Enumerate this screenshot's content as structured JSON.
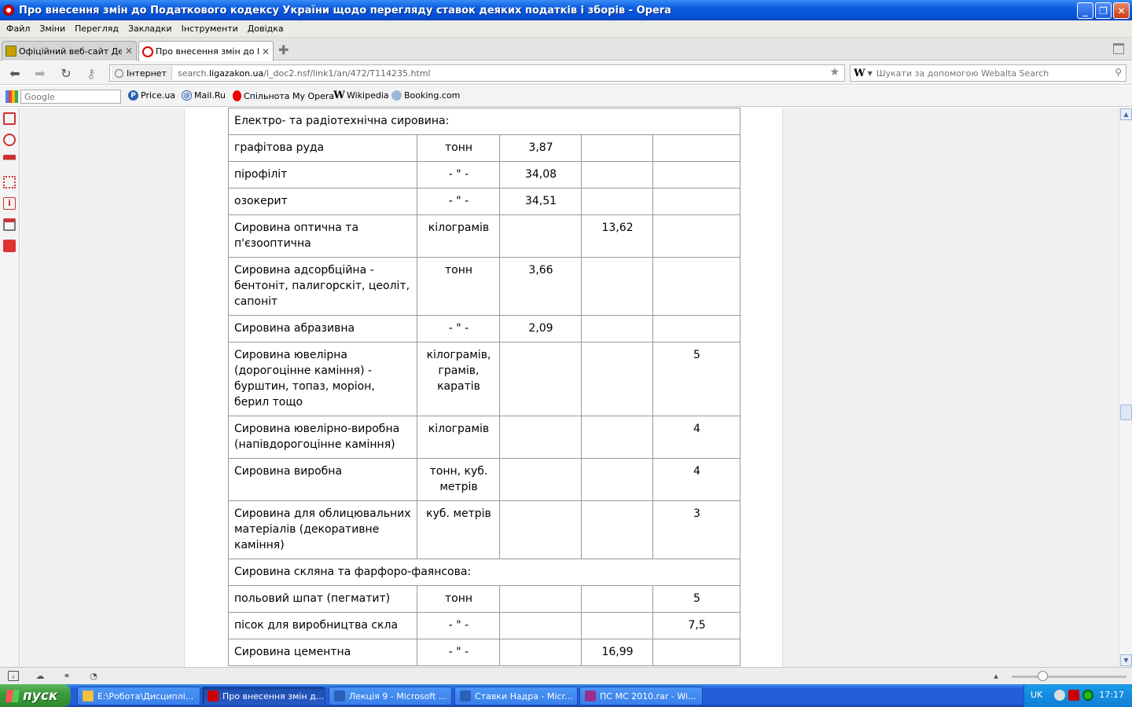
{
  "window": {
    "title": "Про внесення змін до Податкового кодексу України щодо перегляду ставок деяких податків і зборів - Opera"
  },
  "menu": [
    "Файл",
    "Зміни",
    "Перегляд",
    "Закладки",
    "Інструменти",
    "Довідка"
  ],
  "tabs": [
    {
      "label": "Офіційний веб-сайт Де...",
      "active": false
    },
    {
      "label": "Про внесення змін до П...",
      "active": true
    }
  ],
  "address": {
    "security_label": "Інтернет",
    "url_prefix": "search.",
    "url_host": "ligazakon.ua",
    "url_path": "/l_doc2.nsf/link1/an/472/T114235.html"
  },
  "search": {
    "engine": "W",
    "placeholder": "Шукати за допомогою Webalta Search"
  },
  "personal_bar": {
    "google_placeholder": "Google",
    "bookmarks": [
      {
        "label": "Price.ua",
        "icon": "price-icon"
      },
      {
        "label": "Mail.Ru",
        "icon": "mailru-icon"
      },
      {
        "label": "Спільнота My Opera",
        "icon": "opera-icon"
      },
      {
        "label": "Wikipedia",
        "icon": "wikipedia-icon"
      },
      {
        "label": "Booking.com",
        "icon": "booking-icon"
      }
    ]
  },
  "table": {
    "rows": [
      {
        "type": "header",
        "text": "Електро- та радіотехнічна сировина:"
      },
      {
        "type": "data",
        "cells": [
          "графітова руда",
          "тонн",
          "3,87",
          "",
          ""
        ]
      },
      {
        "type": "data",
        "cells": [
          "пірофіліт",
          "- \" -",
          "34,08",
          "",
          ""
        ]
      },
      {
        "type": "data",
        "cells": [
          "озокерит",
          "- \" -",
          "34,51",
          "",
          ""
        ]
      },
      {
        "type": "data",
        "cells": [
          "Сировина оптична та п'єзооптична",
          "кілограмів",
          "",
          "13,62",
          ""
        ]
      },
      {
        "type": "data",
        "cells": [
          "Сировина адсорбційна - бентоніт, палигорскіт, цеоліт, сапоніт",
          "тонн",
          "3,66",
          "",
          ""
        ]
      },
      {
        "type": "data",
        "cells": [
          "Сировина абразивна",
          "- \" -",
          "2,09",
          "",
          ""
        ]
      },
      {
        "type": "data",
        "cells": [
          "Сировина ювелірна (дорогоцінне каміння) - бурштин, топаз, моріон, берил тощо",
          "кілограмів, грамів, каратів",
          "",
          "",
          "5"
        ]
      },
      {
        "type": "data",
        "cells": [
          "Сировина ювелірно-виробна (напівдорогоцінне каміння)",
          "кілограмів",
          "",
          "",
          "4"
        ]
      },
      {
        "type": "data",
        "cells": [
          "Сировина виробна",
          "тонн, куб. метрів",
          "",
          "",
          "4"
        ]
      },
      {
        "type": "data",
        "cells": [
          "Сировина для облицювальних матеріалів (декоративне каміння)",
          "куб. метрів",
          "",
          "",
          "3"
        ]
      },
      {
        "type": "header",
        "text": "Сировина скляна та фарфоро-фаянсова:"
      },
      {
        "type": "data",
        "cells": [
          "польовий шпат (пегматит)",
          "тонн",
          "",
          "",
          "5"
        ]
      },
      {
        "type": "data",
        "cells": [
          "пісок для виробництва скла",
          "- \" -",
          "",
          "",
          "7,5"
        ]
      },
      {
        "type": "data",
        "cells": [
          "Сировина цементна",
          "- \" -",
          "",
          "16,99",
          ""
        ]
      }
    ]
  },
  "taskbar": {
    "start_label": "пуск",
    "tasks": [
      {
        "label": "E:\\Робота\\Дисциплі...",
        "active": false,
        "icon_color": "#f0c040"
      },
      {
        "label": "Про внесення змін д...",
        "active": true,
        "icon_color": "#d00000"
      },
      {
        "label": "Лекція 9 - Microsoft ...",
        "active": false,
        "icon_color": "#2b5fb8"
      },
      {
        "label": "Ставки Надра - Micr...",
        "active": false,
        "icon_color": "#2b5fb8"
      },
      {
        "label": "ПС МС 2010.rar - Wi...",
        "active": false,
        "icon_color": "#9b2f8f"
      }
    ],
    "language": "UK",
    "clock": "17:17"
  }
}
